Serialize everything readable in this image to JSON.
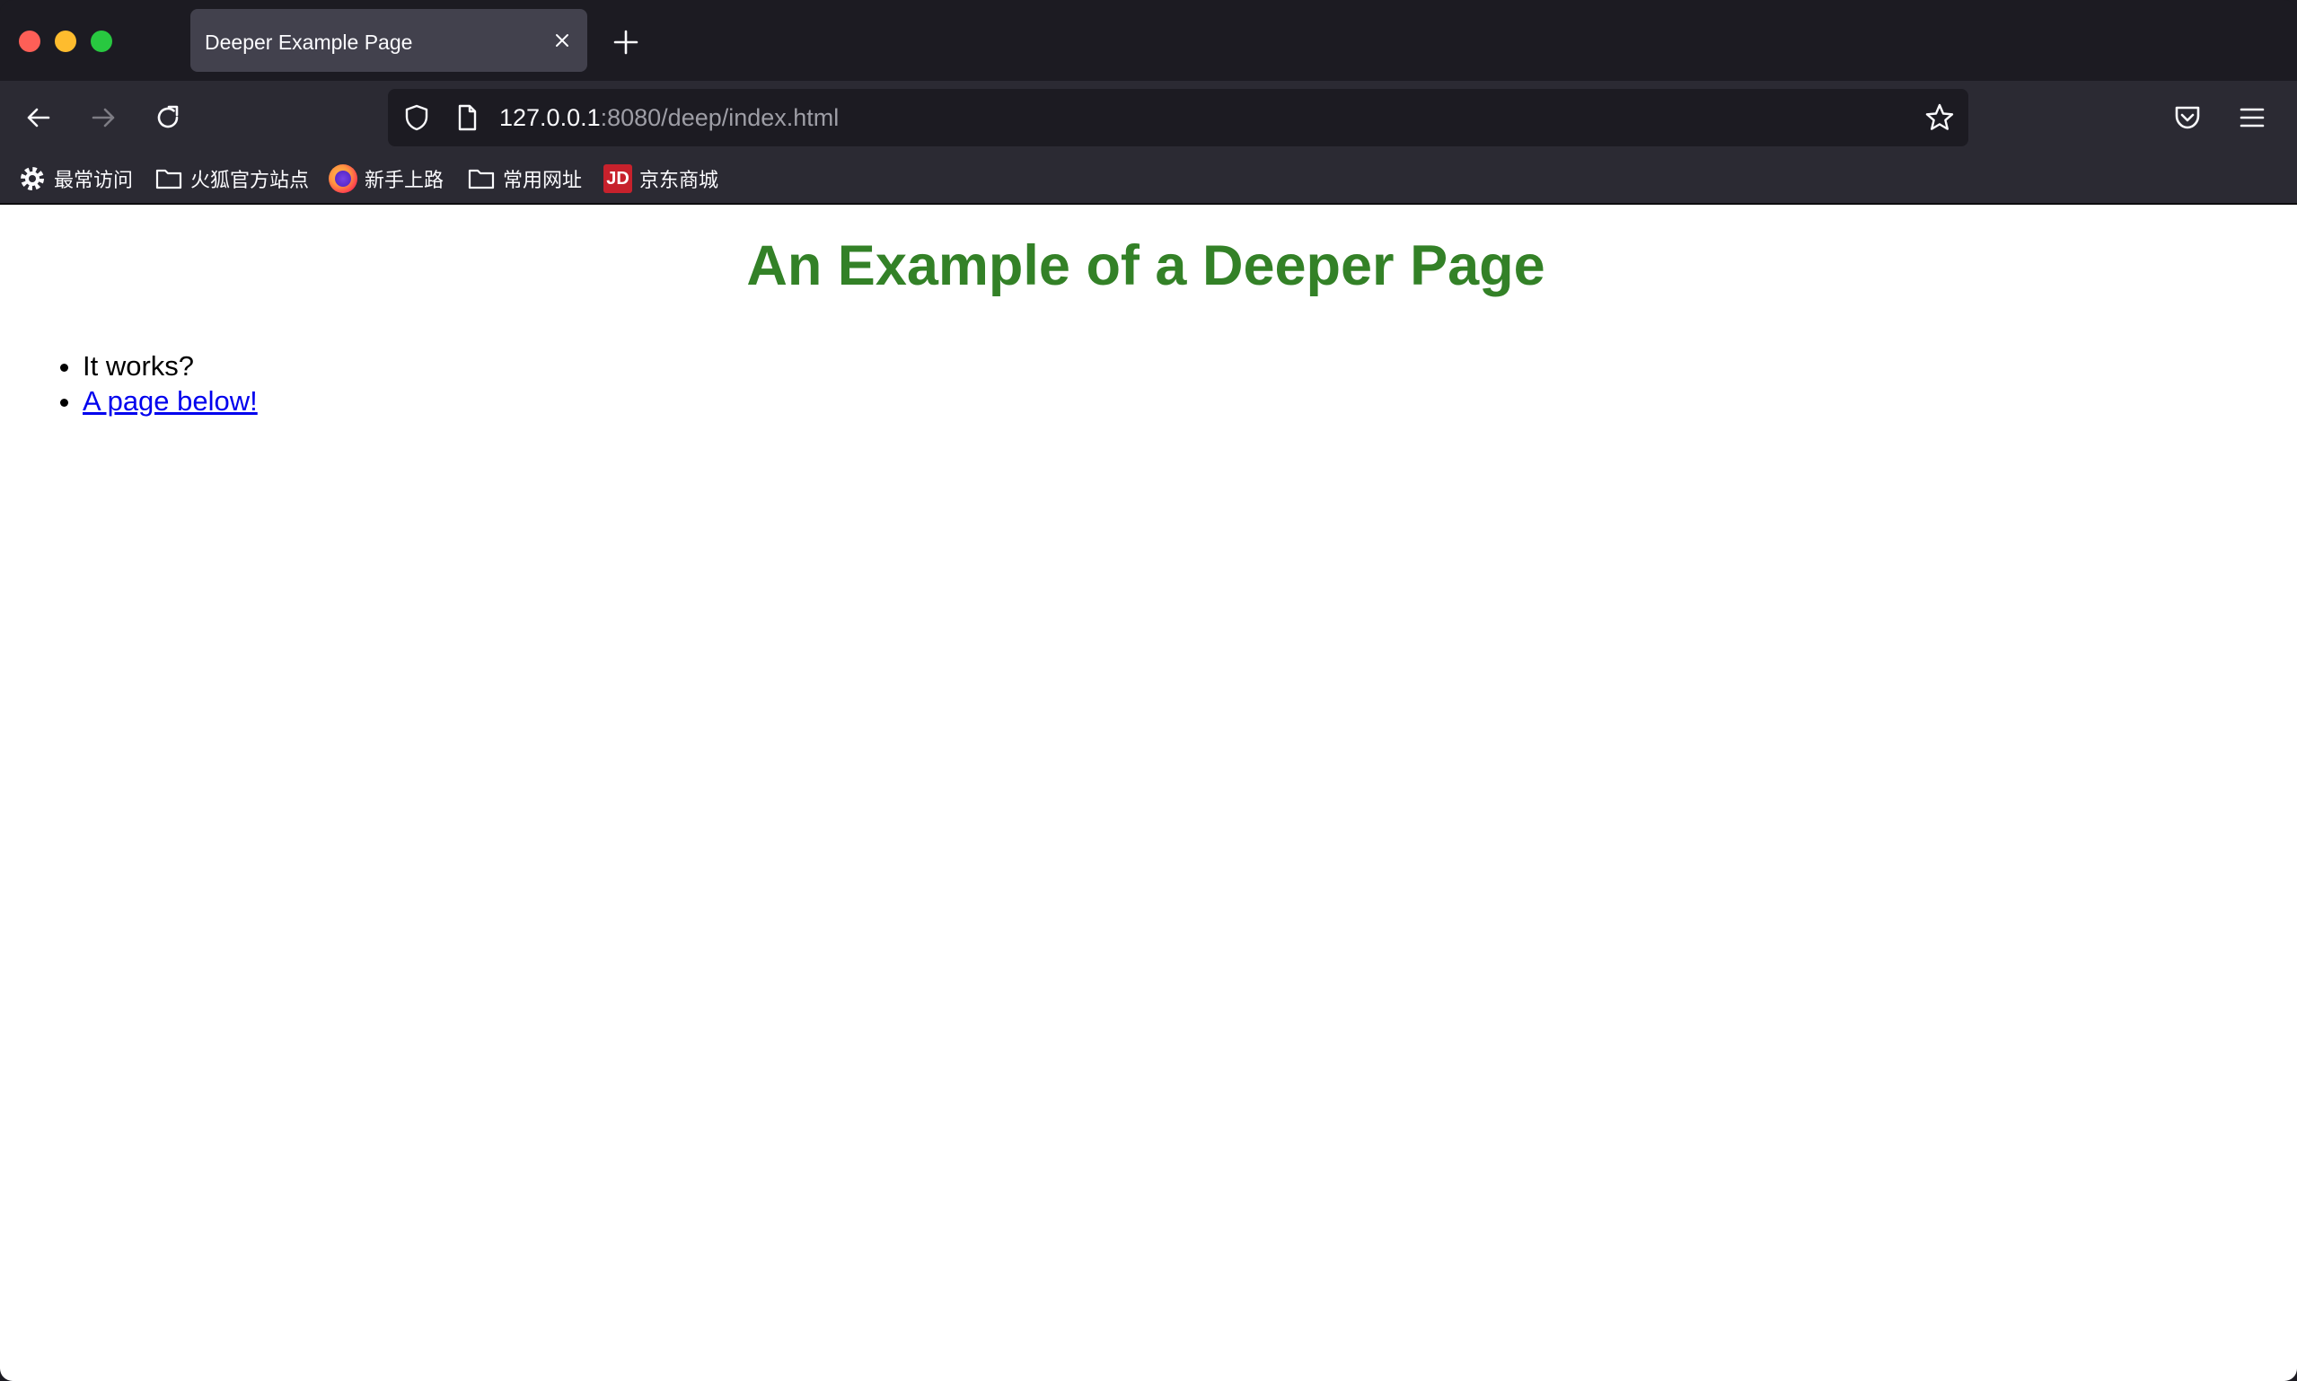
{
  "browser": {
    "tab": {
      "title": "Deeper Example Page"
    },
    "url": {
      "host": "127.0.0.1",
      "rest": ":8080/deep/index.html"
    },
    "bookmarks": [
      {
        "label": "最常访问",
        "icon": "gear-icon"
      },
      {
        "label": "火狐官方站点",
        "icon": "folder-icon"
      },
      {
        "label": "新手上路",
        "icon": "firefox-logo-icon"
      },
      {
        "label": "常用网址",
        "icon": "folder-icon"
      },
      {
        "label": "京东商城",
        "icon": "jd-logo-icon",
        "badge": "JD"
      }
    ]
  },
  "page": {
    "heading": "An Example of a Deeper Page",
    "heading_color": "#338127",
    "items": [
      {
        "text": "It works?"
      },
      {
        "text": "A page below!",
        "link": true
      }
    ]
  }
}
